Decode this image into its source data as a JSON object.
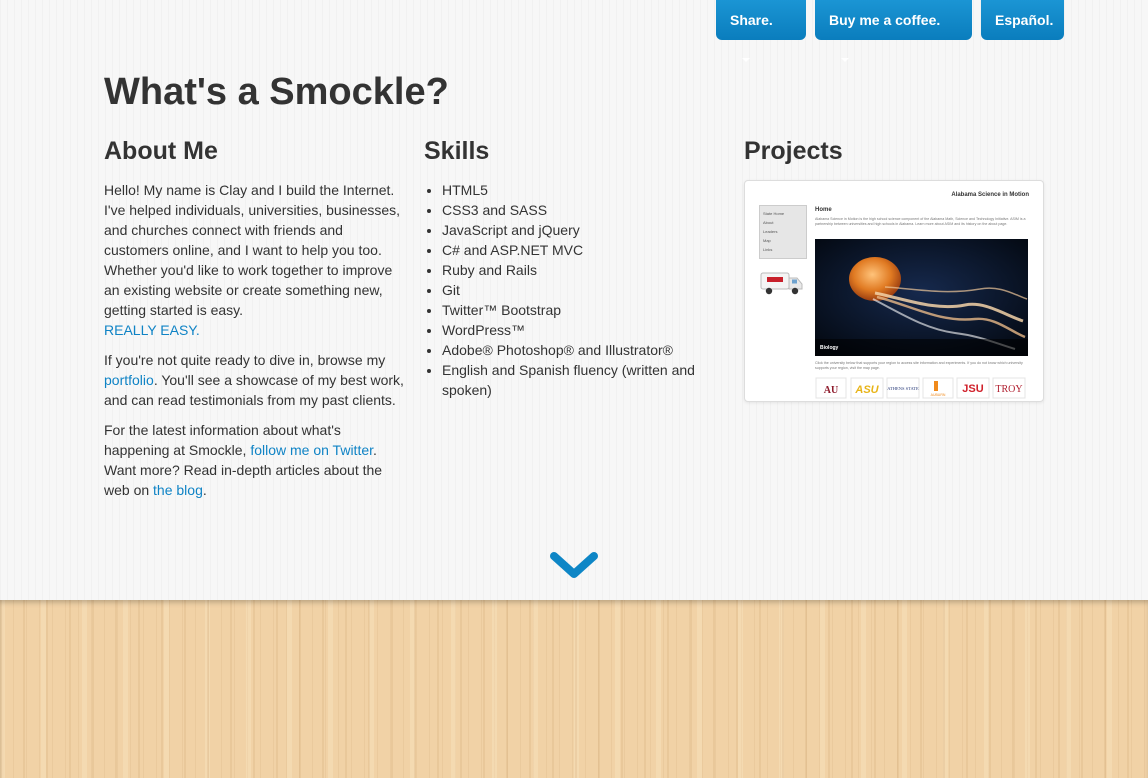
{
  "header": {
    "share_label": "Share.",
    "coffee_label": "Buy me a coffee.",
    "language_label": "Español."
  },
  "page_title": "What's a Smockle?",
  "about": {
    "heading": "About Me",
    "p1_text": "Hello! My name is Clay and I build the Internet. I've helped individuals, universities, businesses, and churches connect with friends and customers online, and I want to help you too. Whether you'd like to work together to improve an existing website or create something new, getting started is easy.",
    "p1_link": "REALLY EASY.",
    "p2_before": "If you're not quite ready to dive in, browse my ",
    "p2_link": "portfolio",
    "p2_after": ". You'll see a showcase of my best work, and can read testimonials from my past clients.",
    "p3_before": "For the latest information about what's happening at Smockle, ",
    "p3_link1": "follow me on Twitter",
    "p3_middle": ". Want more? Read in-depth articles about the web on ",
    "p3_link2": "the blog",
    "p3_after": "."
  },
  "skills": {
    "heading": "Skills",
    "items": [
      "HTML5",
      "CSS3 and SASS",
      "JavaScript and jQuery",
      "C# and ASP.NET MVC",
      "Ruby and Rails",
      "Git",
      "Twitter™ Bootstrap",
      "WordPress™",
      "Adobe® Photoshop® and Illustrator®",
      "English and Spanish fluency (written and spoken)"
    ]
  },
  "projects": {
    "heading": "Projects",
    "thumb": {
      "site_title": "Alabama Science in Motion",
      "nav": [
        "State Home",
        "About",
        "Leaders",
        "Map",
        "Links"
      ],
      "page_heading": "Home",
      "intro": "Alabama Science in Motion is the high school science component of the Alabama Math, Science and Technology Initiative. ASIM is a partnership between universities and high schools in Alabama. Learn more about ASIM and its history on the about page.",
      "image_caption": "Biology",
      "footer_text": "Click the university below that supports your region to access site information and experiments. If you do not know which university supports your region, visit the map page.",
      "logos": [
        "AU",
        "ASU",
        "ATHENS STATE",
        "AUBURN",
        "JSU",
        "TROY"
      ]
    }
  },
  "colors": {
    "accent": "#0e86c6",
    "text": "#333333",
    "link": "#0f83c5",
    "wood": "#f1d2a6"
  },
  "scroll_icon": "chevron-down-icon"
}
